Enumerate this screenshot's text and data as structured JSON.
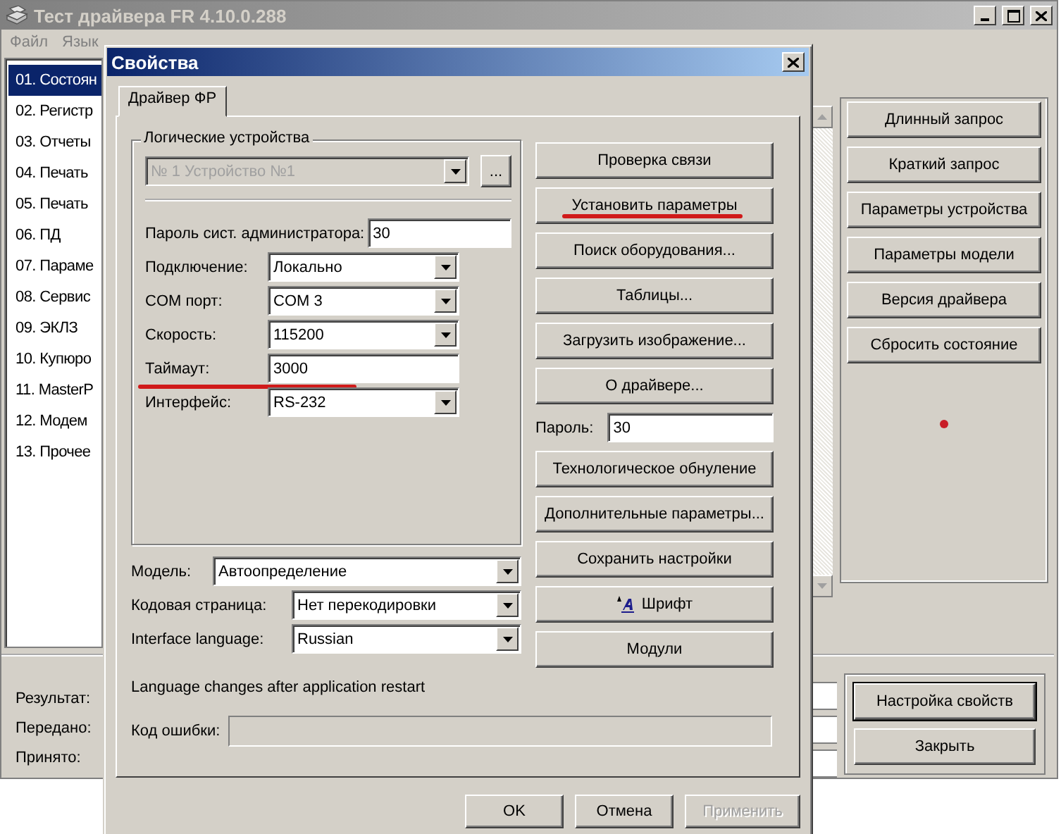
{
  "main_window": {
    "title": "Тест драйвера FR 4.10.0.288",
    "menu": [
      "Файл",
      "Язык"
    ],
    "pages": [
      {
        "label": "01. Состоян",
        "selected": true
      },
      {
        "label": "02. Регистр",
        "selected": false
      },
      {
        "label": "03. Отчеты",
        "selected": false
      },
      {
        "label": "04. Печать",
        "selected": false
      },
      {
        "label": "05. Печать",
        "selected": false
      },
      {
        "label": "06. ПД",
        "selected": false
      },
      {
        "label": "07. Параме",
        "selected": false
      },
      {
        "label": "08. Сервис",
        "selected": false
      },
      {
        "label": "09. ЭКЛЗ",
        "selected": false
      },
      {
        "label": "10. Купюро",
        "selected": false
      },
      {
        "label": "11. MasterP",
        "selected": false
      },
      {
        "label": "12. Модем",
        "selected": false
      },
      {
        "label": "13. Прочее",
        "selected": false
      }
    ],
    "actions": [
      "Длинный запрос",
      "Краткий запрос",
      "Параметры устройства",
      "Параметры модели",
      "Версия драйвера",
      "Сбросить состояние"
    ],
    "status_labels": [
      "Результат:",
      "Передано:",
      "Принято:"
    ],
    "buttons": [
      {
        "label": "Настройка свойств",
        "default": true
      },
      {
        "label": "Закрыть",
        "default": false
      }
    ]
  },
  "dialog": {
    "title": "Свойства",
    "tabs": [
      {
        "label": "Драйвер ФР",
        "selected": true
      }
    ],
    "group": {
      "title": "Логические устройства",
      "device": {
        "value": "№ 1 Устройство №1",
        "disabled": true
      },
      "browse": "..."
    },
    "fields": [
      {
        "label": "Пароль сист. администратора:",
        "kind": "text",
        "value": "30",
        "underlined": false
      },
      {
        "label": "Подключение:",
        "kind": "select",
        "value": "Локально",
        "underlined": false
      },
      {
        "label": "COM порт:",
        "kind": "select",
        "value": "COM 3",
        "underlined": false
      },
      {
        "label": "Скорость:",
        "kind": "select",
        "value": "115200",
        "underlined": false
      },
      {
        "label": "Таймаут:",
        "kind": "text",
        "value": "3000",
        "underlined": true
      },
      {
        "label": "Интерфейс:",
        "kind": "select",
        "value": "RS-232",
        "underlined": false
      }
    ],
    "buttons": [
      {
        "label": "Проверка связи",
        "underlined": false
      },
      {
        "label": "Установить параметры",
        "underlined": true
      },
      {
        "label": "Поиск оборудования...",
        "underlined": false
      },
      {
        "label": "Таблицы...",
        "underlined": false
      },
      {
        "label": "Загрузить изображение...",
        "underlined": false
      },
      {
        "label": "О драйвере...",
        "underlined": false
      }
    ],
    "password": {
      "label": "Пароль:",
      "value": "30"
    },
    "more_buttons": [
      {
        "label": "Технологическое обнуление",
        "kind": "plain"
      },
      {
        "label": "Дополнительные параметры...",
        "kind": "plain"
      },
      {
        "label": "Сохранить настройки",
        "kind": "plain"
      },
      {
        "label": "Шрифт",
        "kind": "font"
      },
      {
        "label": "Модули",
        "kind": "plain"
      }
    ],
    "options": [
      {
        "label": "Модель:",
        "value": "Автоопределение"
      },
      {
        "label": "Кодовая страница:",
        "value": "Нет перекодировки"
      },
      {
        "label": "Interface language:",
        "value": "Russian"
      }
    ],
    "note": "Language changes after application restart",
    "error_code": {
      "label": "Код ошибки:"
    },
    "footer": [
      {
        "label": "OK",
        "disabled": false
      },
      {
        "label": "Отмена",
        "disabled": false
      },
      {
        "label": "Применить",
        "disabled": true
      }
    ]
  }
}
